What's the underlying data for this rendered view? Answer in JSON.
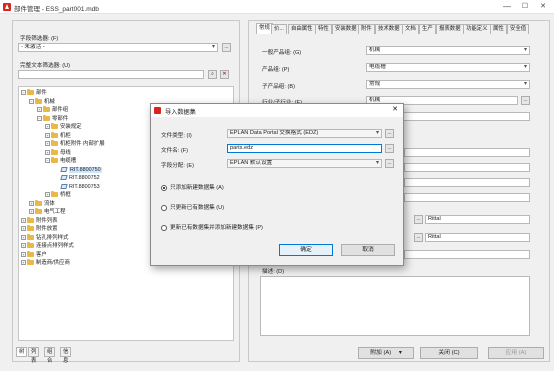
{
  "window": {
    "title": "部件管理 - ESS_part001.mdb",
    "minimize": "—",
    "maximize": "☐",
    "close": "✕"
  },
  "left_panel": {
    "field_filter_label": "字段筛选器: (F)",
    "field_filter_value": "- 未激活 -",
    "fulltext_filter_label": "完整文本筛选器: (U)",
    "fulltext_filter_value": "",
    "tree": [
      {
        "label": "部件",
        "level": 0,
        "expander": "⊟",
        "icon": "folder-icon"
      },
      {
        "label": "机械",
        "level": 1,
        "expander": "⊟",
        "icon": "folder-icon"
      },
      {
        "label": "部件组",
        "level": 2,
        "expander": "⊞",
        "icon": "folder-icon"
      },
      {
        "label": "零部件",
        "level": 2,
        "expander": "⊟",
        "icon": "folder-icon"
      },
      {
        "label": "安装规定",
        "level": 3,
        "expander": "⊞",
        "icon": "folder-icon"
      },
      {
        "label": "机柜",
        "level": 3,
        "expander": "⊞",
        "icon": "folder-icon"
      },
      {
        "label": "机柜附件 内部扩展",
        "level": 3,
        "expander": "⊞",
        "icon": "folder-icon"
      },
      {
        "label": "母线",
        "level": 3,
        "expander": "⊞",
        "icon": "folder-icon"
      },
      {
        "label": "电缆槽",
        "level": 3,
        "expander": "⊟",
        "icon": "folder-icon"
      },
      {
        "label": "RIT.8800750",
        "level": 4,
        "expander": "",
        "icon": "part-icon",
        "selected": true
      },
      {
        "label": "RIT.8800752",
        "level": 4,
        "expander": "",
        "icon": "part-icon"
      },
      {
        "label": "RIT.8800753",
        "level": 4,
        "expander": "",
        "icon": "part-icon"
      },
      {
        "label": "桥框",
        "level": 3,
        "expander": "⊞",
        "icon": "folder-icon"
      },
      {
        "label": "流体",
        "level": 1,
        "expander": "⊞",
        "icon": "folder-icon"
      },
      {
        "label": "电气工程",
        "level": 1,
        "expander": "⊞",
        "icon": "folder-icon"
      },
      {
        "label": "附件列表",
        "level": 0,
        "expander": "⊞",
        "icon": "folder-icon"
      },
      {
        "label": "附件放置",
        "level": 0,
        "expander": "⊞",
        "icon": "folder-icon"
      },
      {
        "label": "钻孔排列样式",
        "level": 0,
        "expander": "⊞",
        "icon": "folder-icon"
      },
      {
        "label": "连接点排列样式",
        "level": 0,
        "expander": "⊞",
        "icon": "folder-icon"
      },
      {
        "label": "客户",
        "level": 0,
        "expander": "⊞",
        "icon": "folder-icon"
      },
      {
        "label": "制造商/供应商",
        "level": 0,
        "expander": "⊞",
        "icon": "folder-icon"
      }
    ],
    "bottom_tabs": [
      "树",
      "列表",
      "组合",
      "信息"
    ]
  },
  "right_panel": {
    "tabs": [
      "常规",
      "价...",
      "自由属性",
      "特性",
      "安装数据",
      "附件",
      "技术数据",
      "文档",
      "生产",
      "报表数据",
      "功能定义",
      "属性",
      "安全值"
    ],
    "fields": [
      {
        "label": "一般产品组: (G)",
        "value": "机械"
      },
      {
        "label": "产品组: (P)",
        "value": "电缆槽"
      },
      {
        "label": "子产品组: (B)",
        "value": "常规"
      },
      {
        "label": "行业/子行业: (E)",
        "value": "机械"
      }
    ],
    "supplier_values": [
      "Rittal",
      "Rittal"
    ],
    "description_label": "描述: (D)",
    "buttons": {
      "attach": "附加 (A)",
      "close": "关闭 (C)",
      "apply": "应用 (A)"
    }
  },
  "dialog": {
    "title": "导入数据集",
    "file_type_label": "文件类型: (I)",
    "file_type_value": "EPLAN Data Portal 交换格式 (EDZ)",
    "file_name_label": "文件名: (F)",
    "file_name_value": "parts.edz",
    "field_assign_label": "字段分配: (E)",
    "field_assign_value": "EPLAN 默认设置",
    "options": [
      {
        "label": "只添加新建数据集 (A)",
        "checked": true
      },
      {
        "label": "只更新已有数据集 (U)",
        "checked": false
      },
      {
        "label": "更新已有数据集并添加新建数据集 (P)",
        "checked": false
      }
    ],
    "ok_label": "确定",
    "cancel_label": "取消",
    "close": "✕"
  }
}
